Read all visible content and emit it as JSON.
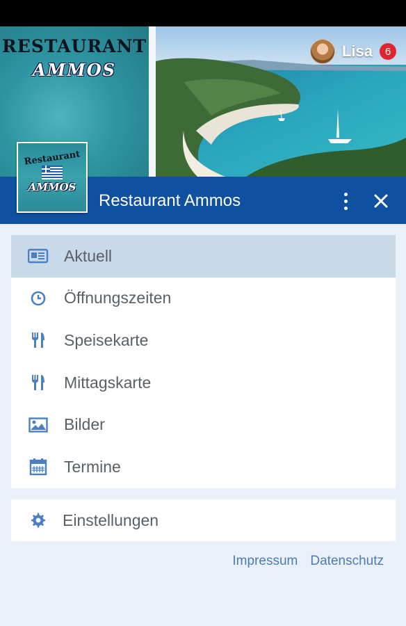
{
  "hero": {
    "brand_title": "RESTAURANT",
    "brand_sub": "AMMOS",
    "user_name": "Lisa",
    "notification_count": "6"
  },
  "logo": {
    "text_top": "Restaurant",
    "text_bottom": "AMMOS"
  },
  "topbar": {
    "title": "Restaurant Ammos"
  },
  "menu": {
    "items": [
      {
        "label": "Aktuell",
        "icon": "newspaper-icon",
        "active": true
      },
      {
        "label": "Öffnungszeiten",
        "icon": "clock-icon"
      },
      {
        "label": "Speisekarte",
        "icon": "cutlery-icon"
      },
      {
        "label": "Mittagskarte",
        "icon": "cutlery-icon"
      },
      {
        "label": "Bilder",
        "icon": "image-icon"
      },
      {
        "label": "Termine",
        "icon": "calendar-icon"
      }
    ],
    "settings_label": "Einstellungen"
  },
  "footer": {
    "impressum": "Impressum",
    "datenschutz": "Datenschutz"
  },
  "colors": {
    "brand_blue": "#0f50a0",
    "icon_blue": "#4a7fc4",
    "active_bg": "#c8d9ea",
    "badge_red": "#e0252f",
    "page_bg": "#eaf0f8"
  }
}
